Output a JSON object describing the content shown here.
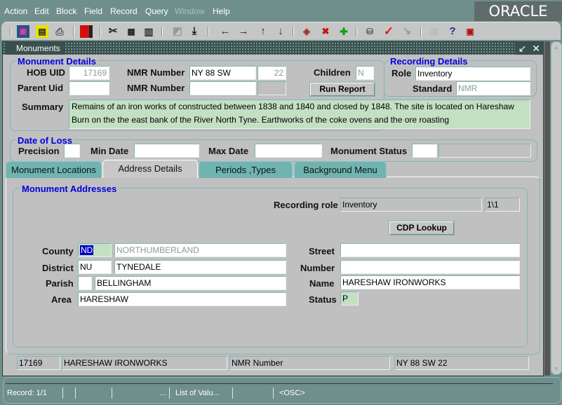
{
  "menubar": {
    "items": [
      {
        "label": "Action",
        "mnemonic": "A",
        "enabled": true
      },
      {
        "label": "Edit",
        "mnemonic": "E",
        "enabled": true
      },
      {
        "label": "Block",
        "mnemonic": "B",
        "enabled": true
      },
      {
        "label": "Field",
        "mnemonic": "F",
        "enabled": true
      },
      {
        "label": "Record",
        "mnemonic": "R",
        "enabled": true
      },
      {
        "label": "Query",
        "mnemonic": "Q",
        "enabled": true
      },
      {
        "label": "Window",
        "mnemonic": "W",
        "enabled": false
      },
      {
        "label": "Help",
        "mnemonic": "H",
        "enabled": true
      }
    ],
    "brand": "ORACLE"
  },
  "toolbar": {
    "icons": [
      "new-window-icon",
      "save-icon",
      "print-icon",
      "exit-icon",
      "cut-icon",
      "copy-icon",
      "paste-icon",
      "clear-icon",
      "download-icon",
      "previous-block-icon",
      "next-block-icon",
      "previous-record-icon",
      "next-record-icon",
      "erase-icon",
      "delete-record-icon",
      "insert-record-icon",
      "query-icon",
      "commit-check-icon",
      "execute-query-icon",
      "keyboard-icon",
      "help-icon",
      "forms-icon"
    ]
  },
  "window": {
    "title": "Monuments",
    "controls": {
      "minimize": "↙",
      "close": "✕"
    }
  },
  "monument_details": {
    "group_title": "Monument Details",
    "hob_uid_label": "HOB UID",
    "hob_uid": "17169",
    "nmr_number_label": "NMR Number",
    "nmr_number": "NY 88 SW",
    "nmr_number_suffix": "22",
    "children_label": "Children",
    "children": "N",
    "parent_uid_label": "Parent Uid",
    "parent_uid": "",
    "nmr_number2_label": "NMR Number",
    "nmr_number2": "",
    "nmr_number2_suffix": "",
    "run_report_label": "Run Report",
    "summary_label": "Summary",
    "summary": "Remains of an iron works of constructed between 1838 and 1840 and closed by 1848. The site is located on Hareshaw Burn on the the east bank of the River North Tyne. Earthworks of the coke ovens and the ore roasting"
  },
  "recording_details": {
    "group_title": "Recording Details",
    "role_label": "Role",
    "role": "Inventory",
    "standard_label": "Standard",
    "standard": "NMR"
  },
  "date_of_loss": {
    "group_title": "Date of Loss",
    "precision_label": "Precision",
    "precision": "",
    "min_date_label": "Min Date",
    "min_date": "",
    "max_date_label": "Max Date",
    "max_date": "",
    "monument_status_label": "Monument Status",
    "monument_status": "",
    "monument_status_desc": ""
  },
  "tabs": [
    {
      "label": "Monument Locations",
      "active": false
    },
    {
      "label": "Address Details",
      "active": true
    },
    {
      "label": "Periods ,Types",
      "active": false
    },
    {
      "label": "Background Menu",
      "active": false
    }
  ],
  "addresses": {
    "group_title": "Monument Addresses",
    "recording_role_label": "Recording role",
    "recording_role": "Inventory",
    "record_counter": "1\\1",
    "cdp_lookup_label": "CDP Lookup",
    "county_label": "County",
    "county_code": "ND",
    "county_name": "NORTHUMBERLAND",
    "district_label": "District",
    "district_code": "NU",
    "district_name": "TYNEDALE",
    "parish_label": "Parish",
    "parish_code": "",
    "parish_name": "BELLINGHAM",
    "area_label": "Area",
    "area": "HARESHAW",
    "street_label": "Street",
    "street": "",
    "number_label": "Number",
    "number": "",
    "name_label": "Name",
    "name": "HARESHAW IRONWORKS",
    "status_label": "Status",
    "status": "P"
  },
  "footer_record": {
    "uid": "17169",
    "name": "HARESHAW IRONWORKS",
    "number_type": "NMR Number",
    "number": "NY 88 SW 22"
  },
  "statusbar": {
    "record": "Record: 1/1",
    "cell2": "",
    "cell3": "",
    "cell4": "...",
    "lov": "List of Valu...",
    "cell6": "",
    "osc": "<OSC>"
  },
  "colors": {
    "frame_teal": "#6f8f8c",
    "group_title_blue": "#0000e0",
    "highlight_green": "#c3e0c3",
    "selection_blue": "#0000c8"
  }
}
